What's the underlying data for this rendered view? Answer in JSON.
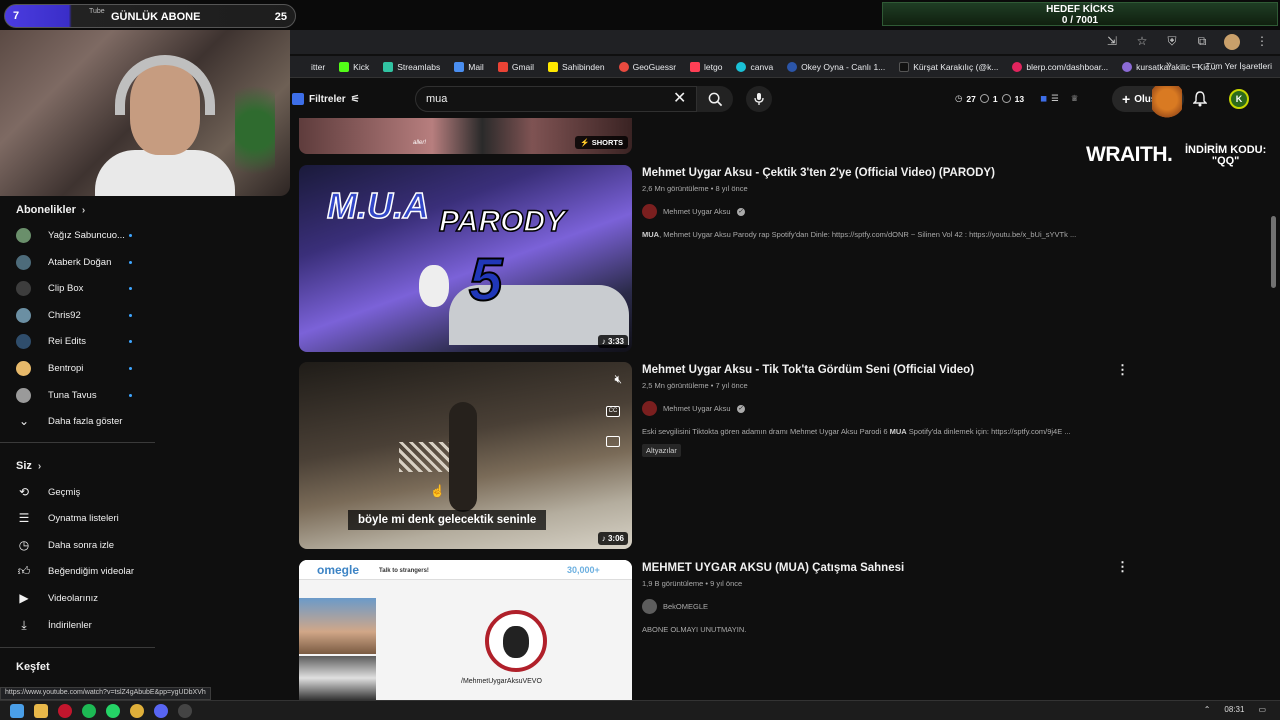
{
  "overlay": {
    "subs_left_count": "7",
    "subs_tube": "Tube",
    "subs_title": "GÜNLÜK ABONE",
    "subs_right_count": "25",
    "kicks_title": "HEDEF KİCKS",
    "kicks_value": "0 / 7001",
    "sponsor": "WRAITH.",
    "promo_line1": "İNDİRİM KODU:",
    "promo_line2": "\"QQ\""
  },
  "bookmarks": [
    {
      "label": "itter",
      "color": "#202124"
    },
    {
      "label": "Kick",
      "color": "#53fc18"
    },
    {
      "label": "Streamlabs",
      "color": "#31c3a2"
    },
    {
      "label": "Mail",
      "color": "#4a8ef0"
    },
    {
      "label": "Gmail",
      "color": "#ea4335"
    },
    {
      "label": "Sahibinden",
      "color": "#ffe800"
    },
    {
      "label": "GeoGuessr",
      "color": "#e94a3f"
    },
    {
      "label": "letgo",
      "color": "#ff3f55"
    },
    {
      "label": "canva",
      "color": "#1ac1d6"
    },
    {
      "label": "Okey Oyna - Canlı 1...",
      "color": "#2b55a8"
    },
    {
      "label": "Kürşat Karakılıç (@k...",
      "color": "#111111"
    },
    {
      "label": "blerp.com/dashboar...",
      "color": "#e2245e"
    },
    {
      "label": "kursatkarakilic - Kic...",
      "color": "#8c6bd6"
    }
  ],
  "bookmarks_right": "Tüm Yer İşaretleri",
  "header": {
    "filters_label": "Filtreler",
    "search_value": "mua",
    "stat_views": "27",
    "stat_a": "1",
    "stat_b": "13",
    "create_label": "Oluştur",
    "avatar_letter": "K"
  },
  "sidebar": {
    "subs_title": "Abonelikler",
    "subs": [
      {
        "label": "Yağız Sabuncuo...",
        "color": "#6a8f6b"
      },
      {
        "label": "Ataberk Doğan",
        "color": "#4d6b7a"
      },
      {
        "label": "Clip Box",
        "color": "#3d3d3d"
      },
      {
        "label": "Chris92",
        "color": "#6b8fa3"
      },
      {
        "label": "Rei Edits",
        "color": "#2f4d6b"
      },
      {
        "label": "Bentropi",
        "color": "#e7b96a"
      },
      {
        "label": "Tuna Tavus",
        "color": "#9a9a9a"
      }
    ],
    "show_more": "Daha fazla göster",
    "you_title": "Siz",
    "you_items": [
      {
        "label": "Geçmiş",
        "icon": "history-icon"
      },
      {
        "label": "Oynatma listeleri",
        "icon": "playlists-icon"
      },
      {
        "label": "Daha sonra izle",
        "icon": "watch-later-icon"
      },
      {
        "label": "Beğendiğim videolar",
        "icon": "liked-icon"
      },
      {
        "label": "Videolarınız",
        "icon": "your-videos-icon"
      },
      {
        "label": "İndirilenler",
        "icon": "download-icon"
      }
    ],
    "explore_title": "Keşfet"
  },
  "results": {
    "shorts_badge": "SHORTS",
    "shorts_caption": "aller!",
    "videos": [
      {
        "title": "Mehmet Uygar Aksu - Çektik 3'ten 2'ye (Official Video) (PARODY)",
        "views": "2,6 Mn görüntüleme",
        "age": "8 yıl önce",
        "channel": "Mehmet Uygar Aksu",
        "desc_bold": "MUA",
        "desc_rest": ", Mehmet Uygar Aksu Parody rap Spotify'dan Dinle: https://sptfy.com/dONR ~ Silinen Vol 42 : https://youtu.be/x_bUi_sYVTk ...",
        "duration": "3:33",
        "thumb_text1": "M.U.A",
        "thumb_text2": "PARODY",
        "thumb_text3": "5"
      },
      {
        "title": "Mehmet Uygar Aksu - Tik Tok'ta Gördüm Seni (Official Video)",
        "views": "2,5 Mn görüntüleme",
        "age": "7 yıl önce",
        "channel": "Mehmet Uygar Aksu",
        "desc_pre": "Eski sevgilisini Tiktokta gören adamın dramı Mehmet Uygar Aksu Parodi 6 ",
        "desc_bold": "MUA",
        "desc_rest": " Spotify'da dinlemek için: https://sptfy.com/9j4E ...",
        "tag": "Altyazılar",
        "duration": "3:06",
        "subtitle": "böyle mi denk gelecektik seninle"
      },
      {
        "title": "MEHMET UYGAR AKSU (MUA) Çatışma Sahnesi",
        "views": "1,9 B görüntüleme",
        "age": "9 yıl önce",
        "channel": "BekOMEGLE",
        "desc_rest": "ABONE OLMAYI UNUTMAYIN.",
        "thumb_logo": "omegle",
        "thumb_talk": "Talk to strangers!",
        "thumb_count": "30,000+",
        "thumb_link": "/MehmetUygarAksuVEVO"
      }
    ]
  },
  "status_url": "https://www.youtube.com/watch?v=tslZ4gAbubE&pp=ygUDbXVh",
  "clock": "08:31"
}
